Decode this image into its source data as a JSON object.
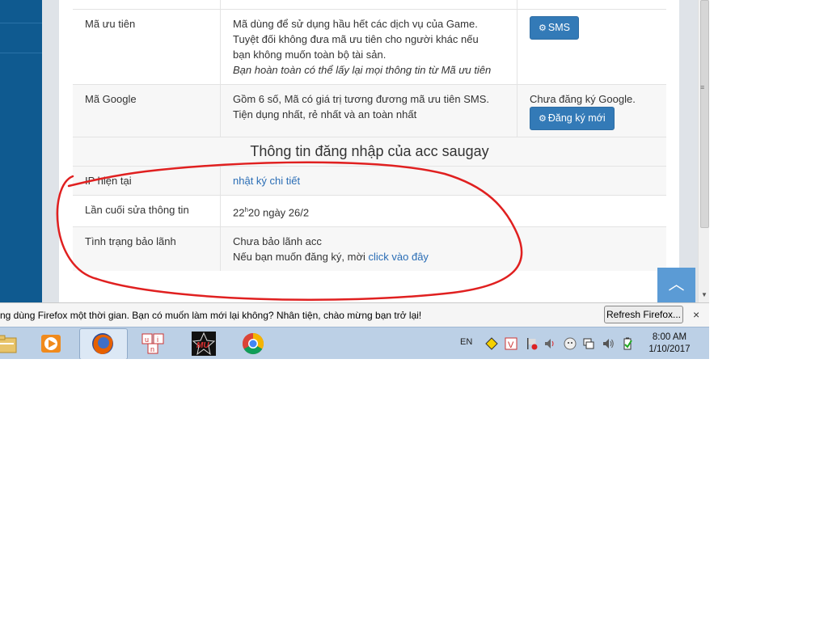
{
  "rows": {
    "priority": {
      "label": "Mã ưu tiên",
      "desc_line1": "Mã dùng để sử dụng hầu hết các dịch vụ của Game.",
      "desc_line2": "Tuyệt đối không đưa mã ưu tiên cho người khác nếu",
      "desc_line3": "bạn không muốn toàn bộ tài sản.",
      "desc_italic": "Bạn hoàn toàn có thể lấy lại mọi thông tin từ Mã ưu tiên",
      "button": "SMS"
    },
    "google": {
      "label": "Mã Google",
      "desc_line1": "Gồm 6 số, Mã có giá trị tương đương mã ưu tiên SMS.",
      "desc_line2": "Tiện dụng nhất, rẻ nhất và an toàn nhất",
      "status": "Chưa đăng ký Google.",
      "button": "Đăng ký mới"
    }
  },
  "section_title": "Thông tin đăng nhập của acc saugay",
  "login_rows": {
    "ip": {
      "label": "IP hiện tại",
      "value": "nhật ký chi tiết"
    },
    "last_edit": {
      "label": "Lần cuối sửa thông tin",
      "hour": "22",
      "sup": "h",
      "rest": "20 ngày 26/2"
    },
    "guarantee": {
      "label": "Tình trạng bảo lãnh",
      "line1": "Chưa bảo lãnh acc",
      "line2_prefix": "Nếu bạn muốn đăng ký, mời ",
      "line2_link": "click vào đây"
    }
  },
  "scroll_top_icon": "chevron-up-icon",
  "notification": {
    "message": "ng dùng Firefox một thời gian. Bạn có muốn làm mới lại không? Nhân tiện, chào mừng bạn trở lại!",
    "button": "Refresh Firefox...",
    "close": "×"
  },
  "taskbar": {
    "language": "EN",
    "time": "8:00 AM",
    "date": "1/10/2017",
    "apps": [
      "file-explorer-icon",
      "media-player-icon",
      "firefox-icon",
      "unikey-icon",
      "mu-game-icon",
      "chrome-icon"
    ]
  },
  "colors": {
    "primary": "#337ab7",
    "link": "#2a6db5",
    "annotation": "#e02020",
    "taskbar": "#bcd0e6",
    "left_bg": "#0f5a90"
  }
}
